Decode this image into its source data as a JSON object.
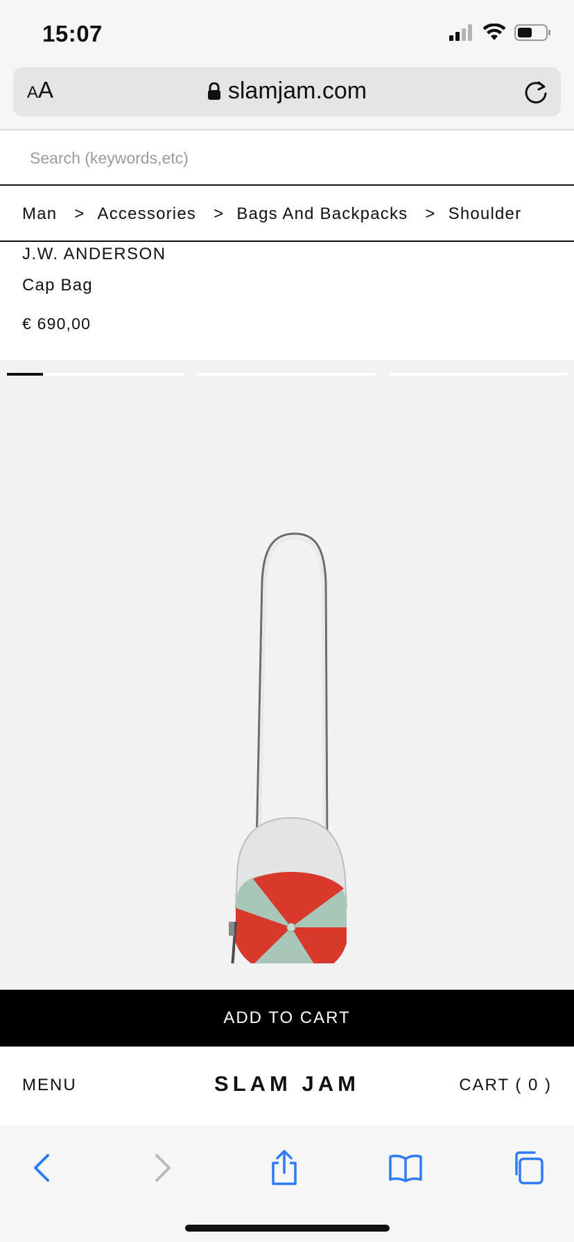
{
  "status": {
    "time": "15:07"
  },
  "browser": {
    "text_size_label_small": "A",
    "text_size_label_big": "A",
    "url": "slamjam.com"
  },
  "search": {
    "placeholder": "Search (keywords,etc)"
  },
  "breadcrumb": [
    {
      "label": "Man"
    },
    {
      "label": "Accessories"
    },
    {
      "label": "Bags And Backpacks"
    },
    {
      "label": "Shoulder"
    }
  ],
  "breadcrumb_separator": ">",
  "product": {
    "brand": "J.W. ANDERSON",
    "name": "Cap Bag",
    "price": "€ 690,00"
  },
  "gallery": {
    "image_count": 3,
    "active_index": 0
  },
  "actions": {
    "add_to_cart": "ADD TO CART"
  },
  "footer_nav": {
    "menu": "MENU",
    "logo": "SLAM JAM",
    "cart": "CART ( 0 )"
  },
  "toolbar_icons": [
    "back-icon",
    "forward-icon",
    "share-icon",
    "bookmarks-icon",
    "tabs-icon"
  ],
  "colors": {
    "accent": "#2f7bf5",
    "cart_button": "#000000",
    "bag_red": "#d8392b",
    "bag_mint": "#a9c7b8"
  }
}
